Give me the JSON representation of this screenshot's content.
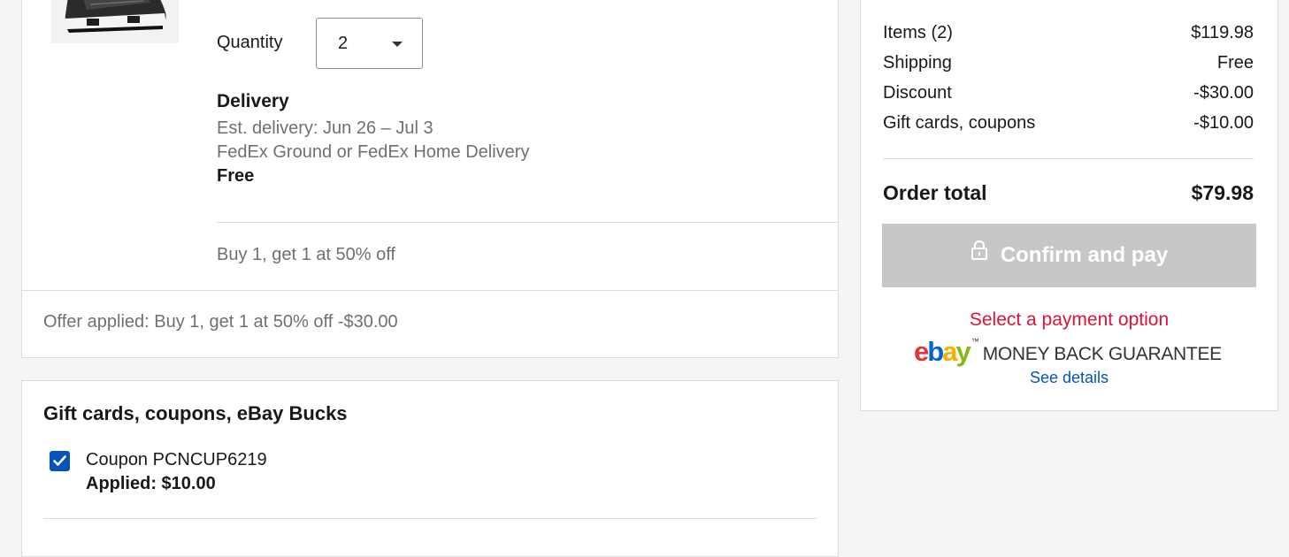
{
  "item": {
    "quantity_label": "Quantity",
    "quantity_value": "2",
    "delivery_title": "Delivery",
    "delivery_estimate": "Est. delivery: Jun 26 – Jul 3",
    "delivery_carrier": "FedEx Ground or FedEx Home Delivery",
    "delivery_cost": "Free",
    "promotion": "Buy 1, get 1 at 50% off",
    "offer_applied": "Offer applied: Buy 1, get 1 at 50% off -$30.00"
  },
  "coupons": {
    "heading": "Gift cards, coupons, eBay Bucks",
    "coupon_label": "Coupon PCNCUP6219",
    "coupon_applied": "Applied: $10.00",
    "checked": true
  },
  "summary": {
    "items_label": "Items (2)",
    "items_value": "$119.98",
    "shipping_label": "Shipping",
    "shipping_value": "Free",
    "discount_label": "Discount",
    "discount_value": "-$30.00",
    "gift_label": "Gift cards, coupons",
    "gift_value": "-$10.00",
    "total_label": "Order total",
    "total_value": "$79.98",
    "confirm_label": "Confirm and pay",
    "payment_warning": "Select a payment option",
    "guarantee_text": "MONEY BACK GUARANTEE",
    "see_details": "See details"
  },
  "logo": {
    "e": "e",
    "b": "b",
    "a": "a",
    "y": "y",
    "tm": "™"
  },
  "icons": {
    "caret": "caret-down-icon",
    "lock": "lock-icon",
    "check": "check-icon"
  },
  "colors": {
    "accent": "#0654ba",
    "warning": "#e0103a",
    "disabled_button": "#c7c7c7"
  }
}
